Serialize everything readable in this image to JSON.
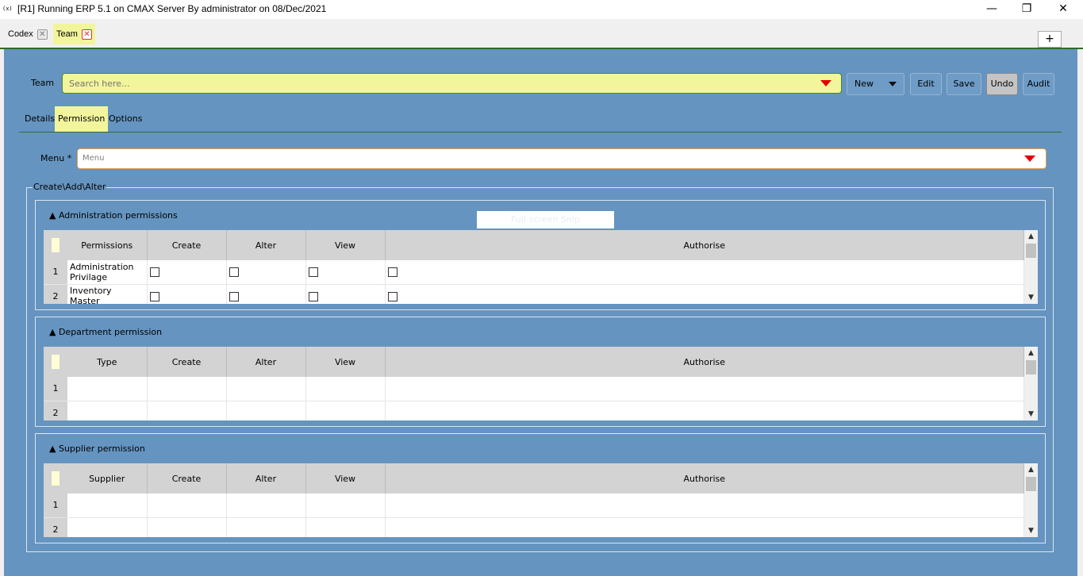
{
  "window": {
    "icon_text": "(x)",
    "title": "[R1] Running ERP 5.1 on CMAX Server By administrator on 08/Dec/2021",
    "controls": {
      "minimize": "—",
      "restore": "❐",
      "close": "✕"
    }
  },
  "tabs": [
    {
      "label": "Codex",
      "close": "✕"
    },
    {
      "label": "Team",
      "close": "✕"
    }
  ],
  "new_tab_label": "+",
  "team_field": {
    "label": "Team",
    "placeholder": "Search here..."
  },
  "toolbar": {
    "new": "New",
    "edit": "Edit",
    "save": "Save",
    "undo": "Undo",
    "audit": "Audit"
  },
  "subtabs": [
    "Details",
    "Permission",
    "Options"
  ],
  "menu_field": {
    "label": "Menu *",
    "placeholder": "Menu"
  },
  "fieldset_legend": "Create\\Add\\Alter",
  "groups": [
    {
      "title": "▲ Administration permissions",
      "columns": [
        "Permissions",
        "Create",
        "Alter",
        "View",
        "Authorise"
      ],
      "rows": [
        {
          "num": "1",
          "name": "Administration Privilage"
        },
        {
          "num": "2",
          "name": "Inventory Master"
        }
      ]
    },
    {
      "title": "▲ Department permission",
      "columns": [
        "Type",
        "Create",
        "Alter",
        "View",
        "Authorise"
      ],
      "rows": [
        {
          "num": "1",
          "name": ""
        },
        {
          "num": "2",
          "name": ""
        }
      ]
    },
    {
      "title": "▲ Supplier permission",
      "columns": [
        "Supplier",
        "Create",
        "Alter",
        "View",
        "Authorise"
      ],
      "rows": [
        {
          "num": "1",
          "name": ""
        },
        {
          "num": "2",
          "name": ""
        }
      ]
    }
  ],
  "overlay_text": "Full-screen Snip",
  "colors": {
    "panel": "#6594c0",
    "highlight": "#f2f59b",
    "caret": "#e30000",
    "tab_rule": "#2f6b2f"
  }
}
